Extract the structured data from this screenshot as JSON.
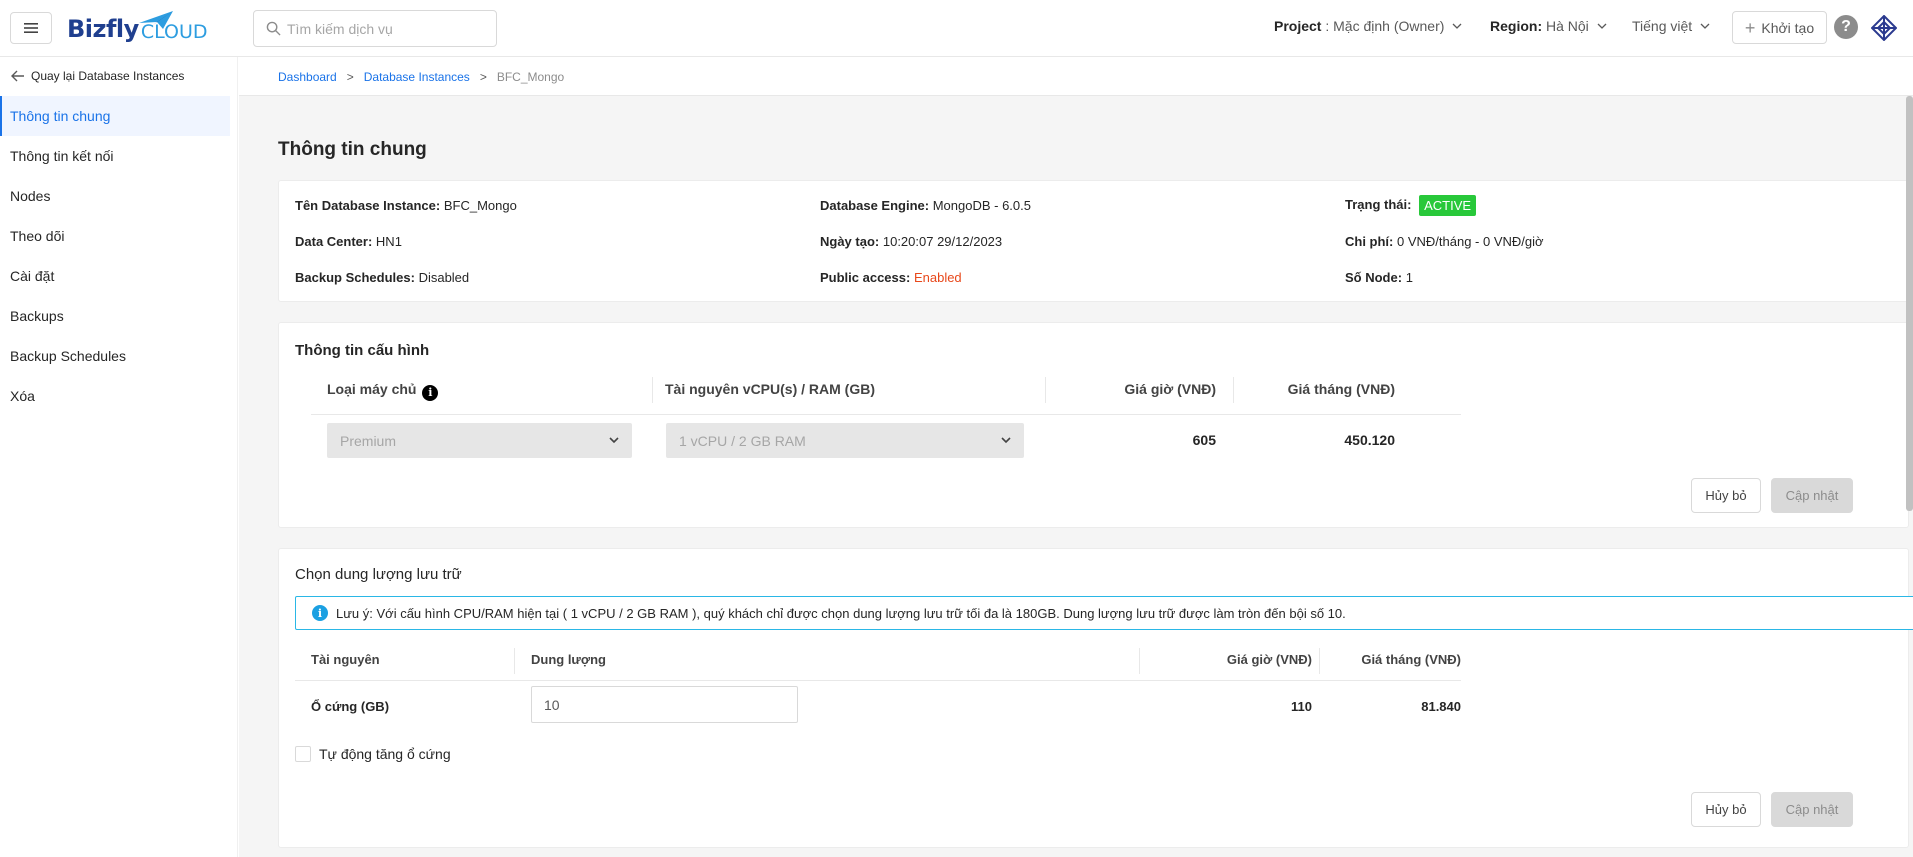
{
  "header": {
    "logo_text_1": "Bizfly",
    "logo_text_2": "CLOUD",
    "search_placeholder": "Tìm kiếm dịch vụ",
    "project_label": "Project",
    "project_value": ": Mặc định (Owner)",
    "region_label": "Region:",
    "region_value": "Hà Nội",
    "language": "Tiếng việt",
    "create_label": "Khởi tạo",
    "help_glyph": "?"
  },
  "sidebar": {
    "back_label": "Quay lại Database Instances",
    "items": [
      {
        "label": "Thông tin chung",
        "active": true
      },
      {
        "label": "Thông tin kết nối"
      },
      {
        "label": "Nodes"
      },
      {
        "label": "Theo dõi"
      },
      {
        "label": "Cài đặt"
      },
      {
        "label": "Backups"
      },
      {
        "label": "Backup Schedules"
      },
      {
        "label": "Xóa"
      }
    ]
  },
  "breadcrumb": {
    "items": [
      "Dashboard",
      "Database Instances",
      "BFC_Mongo"
    ],
    "separator": ">"
  },
  "page": {
    "title": "Thông tin chung"
  },
  "general_info": {
    "name_label": "Tên Database Instance:",
    "name_value": "BFC_Mongo",
    "engine_label": "Database Engine:",
    "engine_value": "MongoDB - 6.0.5",
    "status_label": "Trạng thái:",
    "status_value": "ACTIVE",
    "datacenter_label": "Data Center:",
    "datacenter_value": "HN1",
    "created_label": "Ngày tạo:",
    "created_value": "10:20:07 29/12/2023",
    "cost_label": "Chi phí:",
    "cost_value": "0 VNĐ/tháng - 0 VNĐ/giờ",
    "backup_label": "Backup Schedules:",
    "backup_value": "Disabled",
    "public_label": "Public access:",
    "public_value": "Enabled",
    "nodes_label": "Số Node:",
    "nodes_value": "1"
  },
  "config": {
    "title": "Thông tin cấu hình",
    "col_server_type": "Loại máy chủ",
    "col_resources": "Tài nguyên vCPU(s) / RAM (GB)",
    "col_hour_price": "Giá giờ (VNĐ)",
    "col_month_price": "Giá tháng (VNĐ)",
    "server_type_value": "Premium",
    "resources_value": "1 vCPU / 2 GB RAM",
    "hour_price": "605",
    "month_price": "450.120",
    "cancel_label": "Hủy bỏ",
    "update_label": "Cập nhật"
  },
  "storage": {
    "title": "Chọn dung lượng lưu trữ",
    "note": "Lưu ý: Với cấu hình CPU/RAM hiện tại ( 1 vCPU / 2 GB RAM ), quý khách chỉ được chọn dung lượng lưu trữ tối đa là 180GB. Dung lượng lưu trữ được làm tròn đến bội số 10.",
    "note_icon": "i",
    "col_resource": "Tài nguyên",
    "col_capacity": "Dung lượng",
    "col_hour_price": "Giá giờ (VNĐ)",
    "col_month_price": "Giá tháng (VNĐ)",
    "row_label": "Ổ cứng (GB)",
    "capacity_value": "10",
    "hour_price": "110",
    "month_price": "81.840",
    "auto_increase_label": "Tự động tăng ổ cứng",
    "cancel_label": "Hủy bỏ",
    "update_label": "Cập nhật"
  },
  "colors": {
    "accent": "#1a73e8",
    "active_badge": "#28c83a",
    "enabled_text": "#e8481b",
    "note_border": "#2ab7e6"
  }
}
